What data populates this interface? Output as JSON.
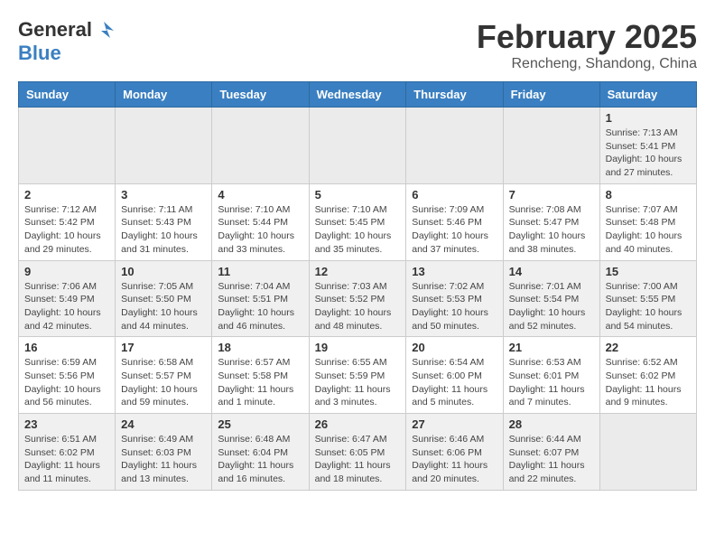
{
  "logo": {
    "general": "General",
    "blue": "Blue"
  },
  "title": "February 2025",
  "subtitle": "Rencheng, Shandong, China",
  "weekdays": [
    "Sunday",
    "Monday",
    "Tuesday",
    "Wednesday",
    "Thursday",
    "Friday",
    "Saturday"
  ],
  "weeks": [
    [
      {
        "day": "",
        "info": ""
      },
      {
        "day": "",
        "info": ""
      },
      {
        "day": "",
        "info": ""
      },
      {
        "day": "",
        "info": ""
      },
      {
        "day": "",
        "info": ""
      },
      {
        "day": "",
        "info": ""
      },
      {
        "day": "1",
        "info": "Sunrise: 7:13 AM\nSunset: 5:41 PM\nDaylight: 10 hours\nand 27 minutes."
      }
    ],
    [
      {
        "day": "2",
        "info": "Sunrise: 7:12 AM\nSunset: 5:42 PM\nDaylight: 10 hours\nand 29 minutes."
      },
      {
        "day": "3",
        "info": "Sunrise: 7:11 AM\nSunset: 5:43 PM\nDaylight: 10 hours\nand 31 minutes."
      },
      {
        "day": "4",
        "info": "Sunrise: 7:10 AM\nSunset: 5:44 PM\nDaylight: 10 hours\nand 33 minutes."
      },
      {
        "day": "5",
        "info": "Sunrise: 7:10 AM\nSunset: 5:45 PM\nDaylight: 10 hours\nand 35 minutes."
      },
      {
        "day": "6",
        "info": "Sunrise: 7:09 AM\nSunset: 5:46 PM\nDaylight: 10 hours\nand 37 minutes."
      },
      {
        "day": "7",
        "info": "Sunrise: 7:08 AM\nSunset: 5:47 PM\nDaylight: 10 hours\nand 38 minutes."
      },
      {
        "day": "8",
        "info": "Sunrise: 7:07 AM\nSunset: 5:48 PM\nDaylight: 10 hours\nand 40 minutes."
      }
    ],
    [
      {
        "day": "9",
        "info": "Sunrise: 7:06 AM\nSunset: 5:49 PM\nDaylight: 10 hours\nand 42 minutes."
      },
      {
        "day": "10",
        "info": "Sunrise: 7:05 AM\nSunset: 5:50 PM\nDaylight: 10 hours\nand 44 minutes."
      },
      {
        "day": "11",
        "info": "Sunrise: 7:04 AM\nSunset: 5:51 PM\nDaylight: 10 hours\nand 46 minutes."
      },
      {
        "day": "12",
        "info": "Sunrise: 7:03 AM\nSunset: 5:52 PM\nDaylight: 10 hours\nand 48 minutes."
      },
      {
        "day": "13",
        "info": "Sunrise: 7:02 AM\nSunset: 5:53 PM\nDaylight: 10 hours\nand 50 minutes."
      },
      {
        "day": "14",
        "info": "Sunrise: 7:01 AM\nSunset: 5:54 PM\nDaylight: 10 hours\nand 52 minutes."
      },
      {
        "day": "15",
        "info": "Sunrise: 7:00 AM\nSunset: 5:55 PM\nDaylight: 10 hours\nand 54 minutes."
      }
    ],
    [
      {
        "day": "16",
        "info": "Sunrise: 6:59 AM\nSunset: 5:56 PM\nDaylight: 10 hours\nand 56 minutes."
      },
      {
        "day": "17",
        "info": "Sunrise: 6:58 AM\nSunset: 5:57 PM\nDaylight: 10 hours\nand 59 minutes."
      },
      {
        "day": "18",
        "info": "Sunrise: 6:57 AM\nSunset: 5:58 PM\nDaylight: 11 hours\nand 1 minute."
      },
      {
        "day": "19",
        "info": "Sunrise: 6:55 AM\nSunset: 5:59 PM\nDaylight: 11 hours\nand 3 minutes."
      },
      {
        "day": "20",
        "info": "Sunrise: 6:54 AM\nSunset: 6:00 PM\nDaylight: 11 hours\nand 5 minutes."
      },
      {
        "day": "21",
        "info": "Sunrise: 6:53 AM\nSunset: 6:01 PM\nDaylight: 11 hours\nand 7 minutes."
      },
      {
        "day": "22",
        "info": "Sunrise: 6:52 AM\nSunset: 6:02 PM\nDaylight: 11 hours\nand 9 minutes."
      }
    ],
    [
      {
        "day": "23",
        "info": "Sunrise: 6:51 AM\nSunset: 6:02 PM\nDaylight: 11 hours\nand 11 minutes."
      },
      {
        "day": "24",
        "info": "Sunrise: 6:49 AM\nSunset: 6:03 PM\nDaylight: 11 hours\nand 13 minutes."
      },
      {
        "day": "25",
        "info": "Sunrise: 6:48 AM\nSunset: 6:04 PM\nDaylight: 11 hours\nand 16 minutes."
      },
      {
        "day": "26",
        "info": "Sunrise: 6:47 AM\nSunset: 6:05 PM\nDaylight: 11 hours\nand 18 minutes."
      },
      {
        "day": "27",
        "info": "Sunrise: 6:46 AM\nSunset: 6:06 PM\nDaylight: 11 hours\nand 20 minutes."
      },
      {
        "day": "28",
        "info": "Sunrise: 6:44 AM\nSunset: 6:07 PM\nDaylight: 11 hours\nand 22 minutes."
      },
      {
        "day": "",
        "info": ""
      }
    ]
  ]
}
